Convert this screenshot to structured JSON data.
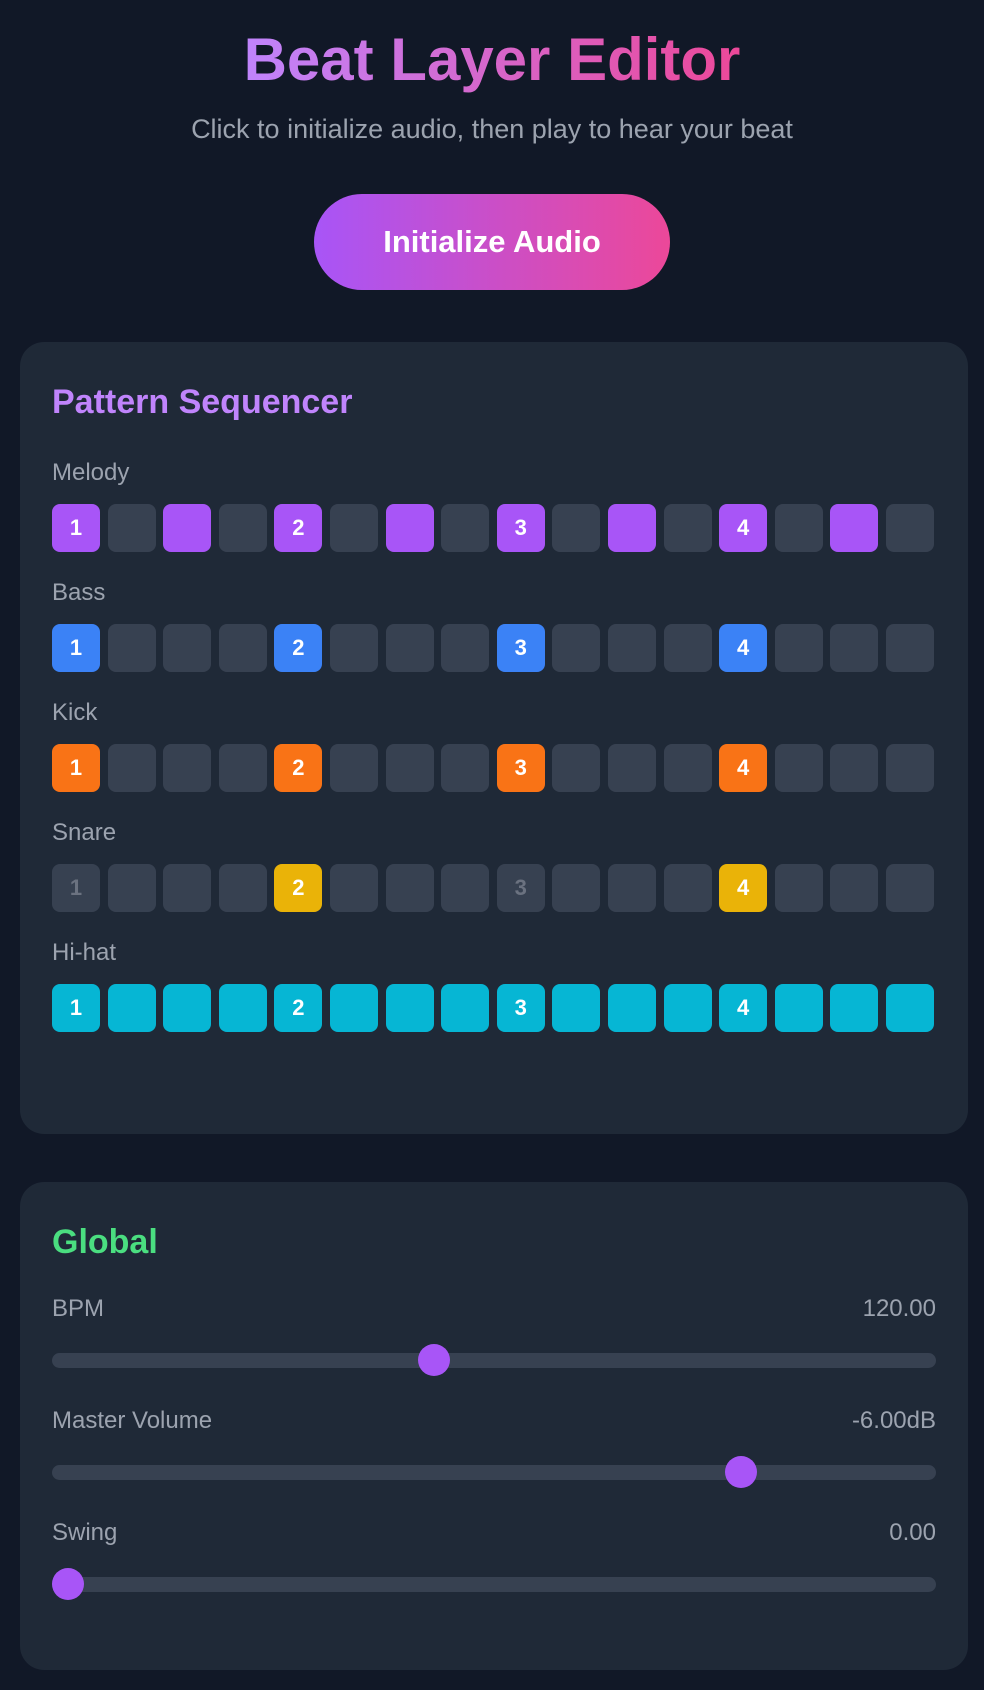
{
  "header": {
    "title": "Beat Layer Editor",
    "subtitle": "Click to initialize audio, then play to hear your beat",
    "init_button": "Initialize Audio"
  },
  "sequencer": {
    "title": "Pattern Sequencer",
    "tracks": [
      {
        "name": "Melody",
        "color": "#a855f7",
        "active": [
          1,
          0,
          1,
          0,
          1,
          0,
          1,
          0,
          1,
          0,
          1,
          0,
          1,
          0,
          1,
          0
        ]
      },
      {
        "name": "Bass",
        "color": "#3b82f6",
        "active": [
          1,
          0,
          0,
          0,
          1,
          0,
          0,
          0,
          1,
          0,
          0,
          0,
          1,
          0,
          0,
          0
        ]
      },
      {
        "name": "Kick",
        "color": "#f97316",
        "active": [
          1,
          0,
          0,
          0,
          1,
          0,
          0,
          0,
          1,
          0,
          0,
          0,
          1,
          0,
          0,
          0
        ]
      },
      {
        "name": "Snare",
        "color": "#eab308",
        "active": [
          0,
          0,
          0,
          0,
          1,
          0,
          0,
          0,
          0,
          0,
          0,
          0,
          1,
          0,
          0,
          0
        ]
      },
      {
        "name": "Hi-hat",
        "color": "#06b6d4",
        "active": [
          1,
          1,
          1,
          1,
          1,
          1,
          1,
          1,
          1,
          1,
          1,
          1,
          1,
          1,
          1,
          1
        ]
      }
    ],
    "beat_labels": [
      "1",
      "",
      "",
      "",
      "2",
      "",
      "",
      "",
      "3",
      "",
      "",
      "",
      "4",
      "",
      "",
      ""
    ]
  },
  "global": {
    "title": "Global",
    "controls": [
      {
        "label": "BPM",
        "value": "120.00",
        "level": 0.43
      },
      {
        "label": "Master Volume",
        "value": "-6.00dB",
        "level": 0.79
      },
      {
        "label": "Swing",
        "value": "0.00",
        "level": 0.0
      }
    ],
    "thumb_color": "#a855f7"
  }
}
